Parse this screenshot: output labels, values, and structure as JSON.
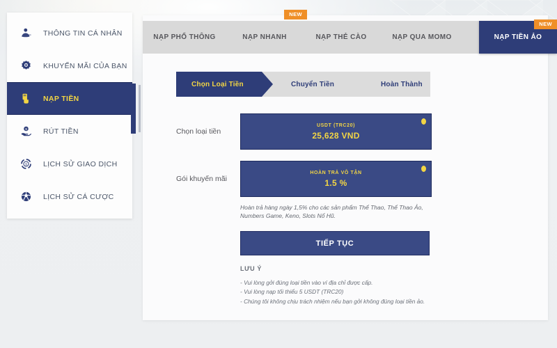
{
  "sidebar": {
    "items": [
      {
        "label": "THÔNG TIN CÁ NHÂN",
        "icon": "user-icon",
        "active": false
      },
      {
        "label": "KHUYẾN MÃI CỦA BẠN",
        "icon": "gift-badge-icon",
        "active": false
      },
      {
        "label": "NẠP TIỀN",
        "icon": "hand-money-icon",
        "active": true
      },
      {
        "label": "RÚT TIỀN",
        "icon": "hand-coin-icon",
        "active": false
      },
      {
        "label": "LỊCH SỬ GIAO DỊCH",
        "icon": "transaction-history-icon",
        "active": false
      },
      {
        "label": "LỊCH SỬ CÁ CƯỢC",
        "icon": "soccer-ball-icon",
        "active": false
      }
    ]
  },
  "tabs": {
    "items": [
      {
        "label": "NẠP PHỔ THÔNG",
        "badge": "",
        "active": false
      },
      {
        "label": "NẠP NHANH",
        "badge": "NEW",
        "active": false
      },
      {
        "label": "NẠP THẺ CÀO",
        "badge": "",
        "active": false
      },
      {
        "label": "NẠP QUA MOMO",
        "badge": "",
        "active": false
      },
      {
        "label": "NẠP TIỀN ẢO",
        "badge": "NEW",
        "active": true
      }
    ]
  },
  "steps": {
    "items": [
      {
        "label": "Chọn Loại Tiền",
        "active": true
      },
      {
        "label": "Chuyển Tiền",
        "active": false
      },
      {
        "label": "Hoàn Thành",
        "active": false
      }
    ]
  },
  "form": {
    "currency_row": {
      "label": "Chọn loại tiền",
      "card_subtitle": "USDT (TRC20)",
      "card_value": "25,628 VND"
    },
    "promo_row": {
      "label": "Gói khuyến mãi",
      "card_subtitle": "HOÀN TRẢ VÔ TẬN",
      "card_value": "1.5 %"
    },
    "promo_note": "Hoàn trả hàng ngày 1,5% cho các sản phẩm Thể Thao, Thể Thao Ảo, Numbers Game, Keno, Slots Nổ Hũ.",
    "continue_label": "TIẾP TỤC"
  },
  "notes": {
    "title": "LƯU Ý",
    "lines": [
      "- Vui lòng gởi đúng loại tiền vào ví địa chỉ được cấp.",
      "- Vui lòng nạp tối thiểu 5 USDT (TRC20)",
      "- Chúng tôi không chịu trách nhiệm nếu bạn gởi không đúng loại tiền ảo."
    ]
  },
  "colors": {
    "navy": "#2e3d78",
    "card_navy": "#3a4a85",
    "gold": "#f2d544",
    "orange_badge": "#ef8f28",
    "tabbar_grey": "#d9d9d9",
    "step_grey": "#dcdcdc"
  }
}
